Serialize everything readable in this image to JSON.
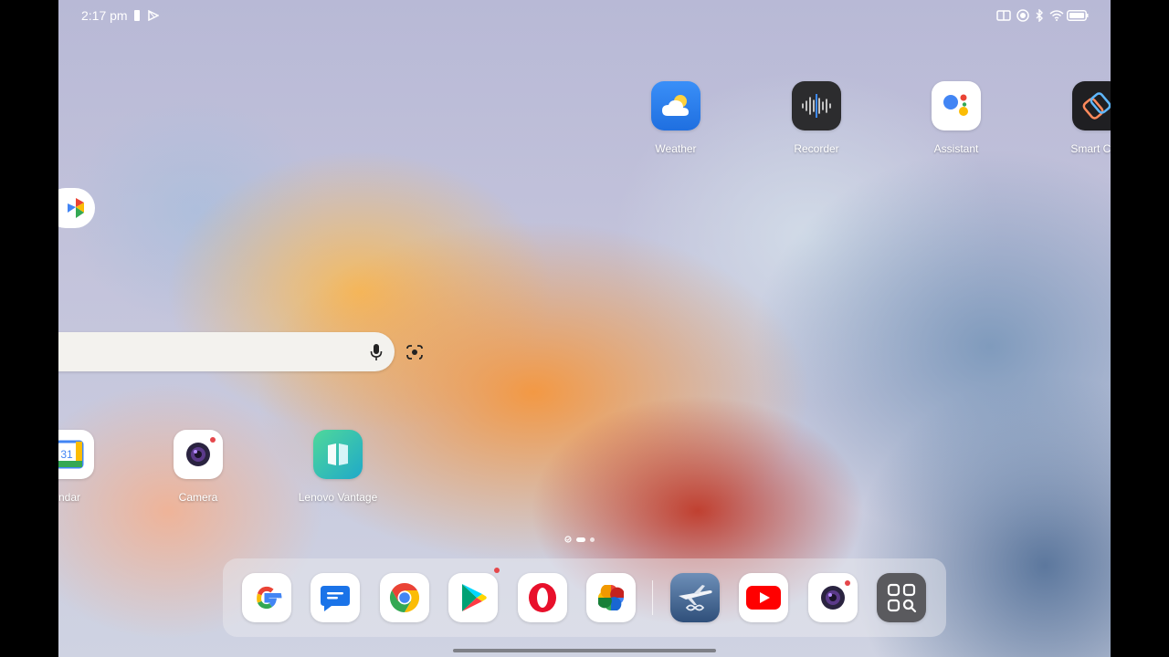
{
  "status_bar": {
    "time": "2:17 pm",
    "left_icons": [
      "battery-small-icon",
      "play-store-icon"
    ],
    "right_icons": [
      "dual-screen-icon",
      "record-icon",
      "bluetooth-icon",
      "wifi-icon",
      "battery-icon"
    ]
  },
  "home": {
    "top_apps": [
      {
        "label": "Weather",
        "icon": "weather-icon"
      },
      {
        "label": "Recorder",
        "icon": "recorder-icon"
      },
      {
        "label": "Assistant",
        "icon": "assistant-icon"
      },
      {
        "label": "Smart Con",
        "icon": "smart-connect-icon"
      }
    ],
    "left_edge_app": {
      "icon": "google-one-icon"
    },
    "search_bar": {
      "placeholder": "",
      "mic_icon": "mic-icon",
      "lens_icon": "lens-icon"
    },
    "row_apps": [
      {
        "label": "ndar",
        "icon": "calendar-icon"
      },
      {
        "label": "Camera",
        "icon": "camera-icon"
      },
      {
        "label": "Lenovo Vantage",
        "icon": "lenovo-vantage-icon"
      }
    ],
    "page_indicator": {
      "pages": 3,
      "current": 2
    }
  },
  "dock": {
    "apps": [
      {
        "icon": "google-icon"
      },
      {
        "icon": "messages-icon"
      },
      {
        "icon": "chrome-icon"
      },
      {
        "icon": "play-store-icon",
        "badge": true
      },
      {
        "icon": "opera-icon"
      },
      {
        "icon": "photos-icon"
      },
      {
        "icon": "flight-game-icon"
      },
      {
        "icon": "youtube-icon"
      },
      {
        "icon": "camera-icon",
        "badge": true
      },
      {
        "icon": "app-drawer-icon"
      }
    ]
  },
  "colors": {
    "weather_bg": "#2f86f5",
    "recorder_bg": "#2c2c2e",
    "vantage_bg": "#27c3a8",
    "badge": "#e5474b"
  }
}
